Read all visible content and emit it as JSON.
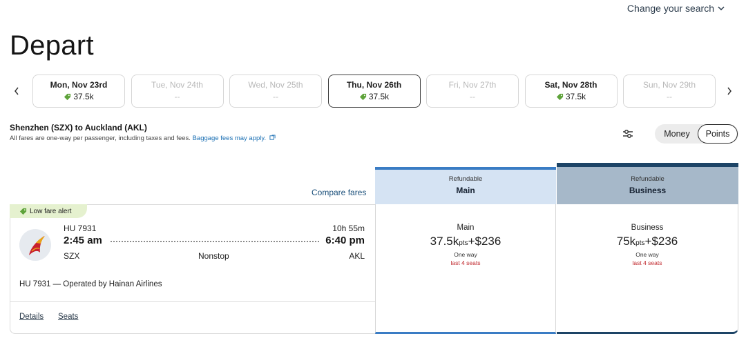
{
  "header": {
    "change_search": "Change your search",
    "title": "Depart"
  },
  "dates": [
    {
      "label": "Mon, Nov 23rd",
      "price": "37.5k",
      "available": true,
      "selected": false
    },
    {
      "label": "Tue, Nov 24th",
      "price": "--",
      "available": false,
      "selected": false
    },
    {
      "label": "Wed, Nov 25th",
      "price": "--",
      "available": false,
      "selected": false
    },
    {
      "label": "Thu, Nov 26th",
      "price": "37.5k",
      "available": true,
      "selected": true
    },
    {
      "label": "Fri, Nov 27th",
      "price": "--",
      "available": false,
      "selected": false
    },
    {
      "label": "Sat, Nov 28th",
      "price": "37.5k",
      "available": true,
      "selected": false
    },
    {
      "label": "Sun, Nov 29th",
      "price": "--",
      "available": false,
      "selected": false
    }
  ],
  "route": {
    "title": "Shenzhen (SZX) to Auckland (AKL)",
    "note": "All fares are one-way per passenger, including taxes and fees.",
    "baggage_link": "Baggage fees may apply."
  },
  "toggle": {
    "money": "Money",
    "points": "Points",
    "selected": "points"
  },
  "compare_fares": "Compare fares",
  "columns": {
    "main": {
      "refundable": "Refundable",
      "name": "Main",
      "accent": "#3a7cc4"
    },
    "business": {
      "refundable": "Refundable",
      "name": "Business",
      "accent": "#1d4466"
    }
  },
  "flight": {
    "badge": "Low fare alert",
    "flight_number": "HU 7931",
    "duration": "10h 55m",
    "depart_time": "2:45 am",
    "arrive_time": "6:40 pm",
    "origin": "SZX",
    "destination": "AKL",
    "stops": "Nonstop",
    "operated_by": "HU 7931 — Operated by Hainan Airlines",
    "details_link": "Details",
    "seats_link": "Seats",
    "fares": {
      "main": {
        "name": "Main",
        "points": "37.5k",
        "pts_unit": "pts",
        "cash": "+$236",
        "trip": "One way",
        "seats": "last 4 seats"
      },
      "business": {
        "name": "Business",
        "points": "75k",
        "pts_unit": "pts",
        "cash": "+$236",
        "trip": "One way",
        "seats": "last 4 seats"
      }
    }
  },
  "icons": {
    "tag": "tag-icon",
    "filter": "sliders-icon",
    "external": "external-link-icon",
    "airline": "hainan-airlines-logo"
  }
}
